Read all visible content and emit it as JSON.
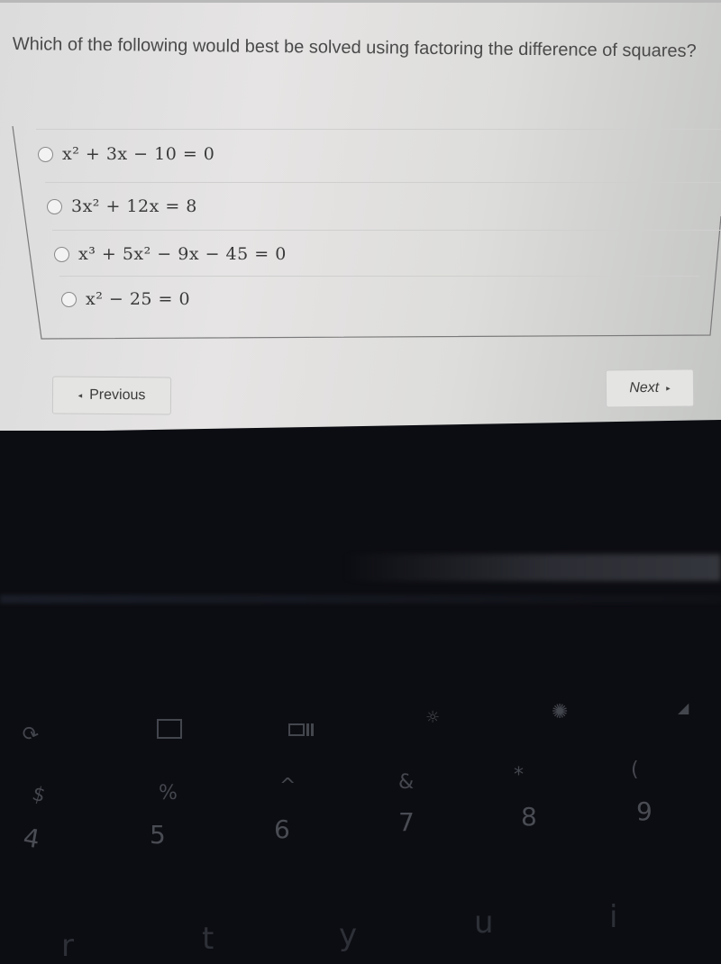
{
  "question": {
    "text": "Which of the following would best be solved using factoring the difference of squares?"
  },
  "options": [
    {
      "id": "a",
      "expression": "x² + 3x − 10 = 0",
      "selected": false
    },
    {
      "id": "b",
      "expression": "3x² + 12x = 8",
      "selected": false
    },
    {
      "id": "c",
      "expression": "x³ + 5x² − 9x − 45 = 0",
      "selected": false
    },
    {
      "id": "d",
      "expression": "x² − 25 = 0",
      "selected": false
    }
  ],
  "navigation": {
    "previous_label": "Previous",
    "previous_icon": "◂",
    "next_label": "Next",
    "next_icon": "▸"
  },
  "keyboard": {
    "function_row": [
      {
        "name": "refresh-icon",
        "glyph": "⟳"
      },
      {
        "name": "fullscreen-icon",
        "glyph": "⬚"
      },
      {
        "name": "overview-icon",
        "glyph": "▭∥"
      },
      {
        "name": "brightness-down-icon",
        "glyph": "☼"
      },
      {
        "name": "brightness-up-icon",
        "glyph": "✺"
      },
      {
        "name": "mute-icon",
        "glyph": "🔇"
      }
    ],
    "number_row": [
      {
        "symbol": "$",
        "digit": "4"
      },
      {
        "symbol": "%",
        "digit": "5"
      },
      {
        "symbol": "^",
        "digit": "6"
      },
      {
        "symbol": "&",
        "digit": "7"
      },
      {
        "symbol": "*",
        "digit": "8"
      },
      {
        "symbol": "(",
        "digit": "9"
      }
    ],
    "letter_row": [
      "r",
      "t",
      "y",
      "u",
      "i"
    ]
  },
  "colors": {
    "screen_background": "#e2e2e0",
    "text": "#4a4a4a",
    "border": "#c9c9c9",
    "bezel": "#0c0d12"
  }
}
